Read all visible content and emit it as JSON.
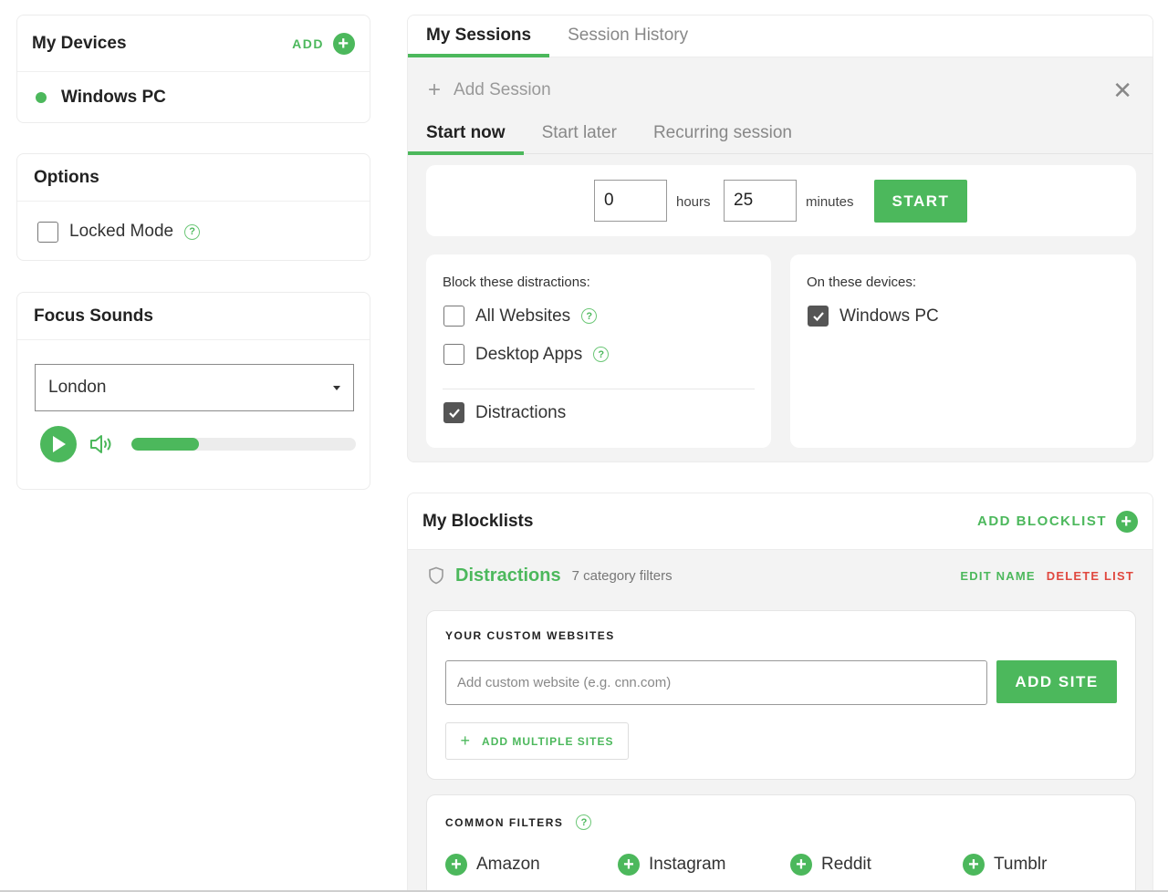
{
  "devices": {
    "title": "My Devices",
    "add_label": "ADD",
    "items": [
      {
        "name": "Windows PC",
        "status_color": "#4cb85c"
      }
    ]
  },
  "options": {
    "title": "Options",
    "locked_mode_label": "Locked Mode",
    "locked_mode_checked": false
  },
  "focus_sounds": {
    "title": "Focus Sounds",
    "selected_sound": "London",
    "volume_fraction": 0.3
  },
  "sessions": {
    "tabs": [
      {
        "label": "My Sessions",
        "active": true
      },
      {
        "label": "Session History",
        "active": false
      }
    ],
    "add_session_label": "Add Session",
    "subtabs": [
      {
        "label": "Start now",
        "active": true
      },
      {
        "label": "Start later",
        "active": false
      },
      {
        "label": "Recurring session",
        "active": false
      }
    ],
    "hours_value": "0",
    "hours_label": "hours",
    "minutes_value": "25",
    "minutes_label": "minutes",
    "start_label": "START",
    "block_label": "Block these distractions:",
    "block_items": [
      {
        "label": "All Websites",
        "checked": false,
        "help": true
      },
      {
        "label": "Desktop Apps",
        "checked": false,
        "help": true
      },
      {
        "label": "Distractions",
        "checked": true,
        "help": false
      }
    ],
    "devices_label": "On these devices:",
    "device_items": [
      {
        "label": "Windows PC",
        "checked": true
      }
    ]
  },
  "blocklists": {
    "title": "My Blocklists",
    "add_label": "ADD BLOCKLIST",
    "list": {
      "name": "Distractions",
      "count_text": "7 category filters",
      "edit_label": "EDIT NAME",
      "delete_label": "DELETE LIST"
    },
    "custom": {
      "label": "YOUR CUSTOM WEBSITES",
      "placeholder": "Add custom website (e.g. cnn.com)",
      "add_site_label": "ADD SITE",
      "add_multiple_label": "ADD MULTIPLE SITES"
    },
    "filters": {
      "label": "COMMON FILTERS",
      "items": [
        "Amazon",
        "Instagram",
        "Reddit",
        "Tumblr"
      ]
    }
  },
  "colors": {
    "accent": "#4cb85c",
    "danger": "#e0483f",
    "panel_bg": "#f3f3f3"
  }
}
